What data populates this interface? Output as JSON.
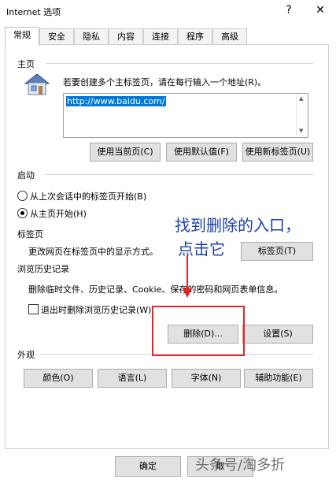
{
  "window": {
    "title": "Internet 选项",
    "help": "?",
    "close": "✕"
  },
  "tabs": [
    "常规",
    "安全",
    "隐私",
    "内容",
    "连接",
    "程序",
    "高级"
  ],
  "homepage": {
    "section": "主页",
    "description": "若要创建多个主标签页，请在每行输入一个地址(R)。",
    "url": "http://www.baidu.com/",
    "buttons": [
      "使用当前页(C)",
      "使用默认值(F)",
      "使用新标签页(U)"
    ]
  },
  "startup": {
    "section": "启动",
    "options": [
      "从上次会话中的标签页开始(B)",
      "从主页开始(H)"
    ],
    "selected": 1
  },
  "tabs_section": {
    "section": "标签页",
    "description": "更改网页在标签页中的显示方式。",
    "button": "标签页(T)"
  },
  "history": {
    "section": "浏览历史记录",
    "description": "删除临时文件、历史记录、Cookie、保存的密码和网页表单信息。",
    "checkbox": "退出时删除浏览历史记录(W)",
    "checked": false,
    "delete_button": "删除(D)...",
    "settings_button": "设置(S)"
  },
  "appearance": {
    "section": "外观",
    "buttons": [
      "颜色(O)",
      "语言(L)",
      "字体(N)",
      "辅助功能(E)"
    ]
  },
  "annotation": {
    "line1": "找到删除的入口，",
    "line2": "点击它",
    "color": "#1a3fb0",
    "box_color": "#e0262b"
  },
  "footer": {
    "ok": "确定",
    "cancel": "取"
  },
  "watermark": "头条号/淘多折"
}
